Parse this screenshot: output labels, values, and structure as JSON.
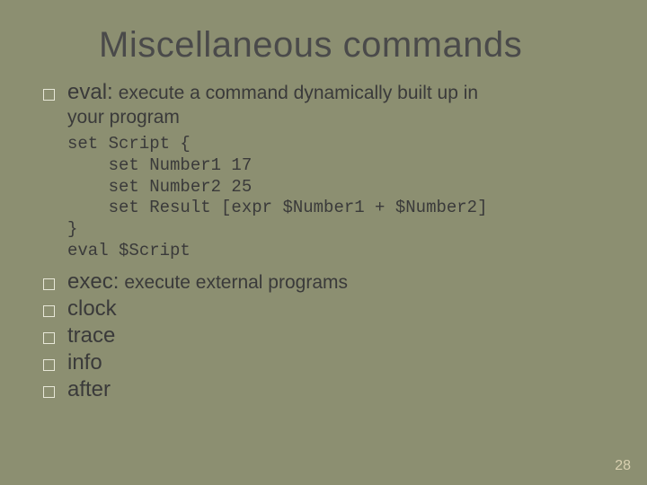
{
  "title": "Miscellaneous commands",
  "items": {
    "eval": {
      "name": "eval:",
      "desc_part1": "execute a command dynamically built up in",
      "desc_part2": "your program"
    },
    "exec": {
      "name": "exec:",
      "desc": "execute external programs"
    },
    "clock": "clock",
    "trace": "trace",
    "info": "info",
    "after": "after"
  },
  "code": "set Script {\n    set Number1 17\n    set Number2 25\n    set Result [expr $Number1 + $Number2]\n}\neval $Script",
  "page_number": "28"
}
